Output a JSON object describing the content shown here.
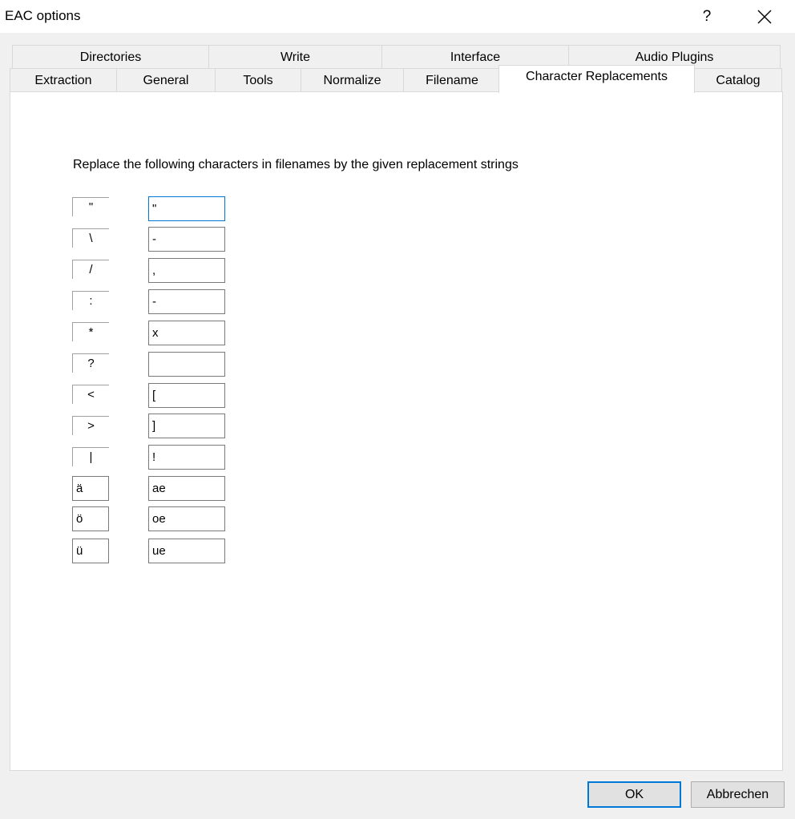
{
  "window": {
    "title": "EAC options",
    "help_glyph": "?",
    "close_glyph": "✕"
  },
  "tabs_back_row": [
    "Directories",
    "Write",
    "Interface",
    "Audio Plugins"
  ],
  "tabs_front_row": [
    "Extraction",
    "General",
    "Tools",
    "Normalize",
    "Filename",
    "Character Replacements",
    "Catalog"
  ],
  "active_tab": "Character Replacements",
  "panel": {
    "instruction": "Replace the following characters in filenames by the given replacement strings",
    "rows": [
      {
        "char": "\"",
        "replacement": "\""
      },
      {
        "char": "\\",
        "replacement": "-"
      },
      {
        "char": "/",
        "replacement": ","
      },
      {
        "char": ":",
        "replacement": "-"
      },
      {
        "char": "*",
        "replacement": "x"
      },
      {
        "char": "?",
        "replacement": ""
      },
      {
        "char": "<",
        "replacement": "["
      },
      {
        "char": ">",
        "replacement": "]"
      },
      {
        "char": "|",
        "replacement": "!"
      },
      {
        "char": "ä",
        "replacement": "ae"
      },
      {
        "char": "ö",
        "replacement": "oe"
      },
      {
        "char": "ü",
        "replacement": "ue"
      }
    ]
  },
  "buttons": {
    "ok": "OK",
    "cancel": "Abbrechen"
  },
  "colors": {
    "accent": "#0078d7"
  }
}
